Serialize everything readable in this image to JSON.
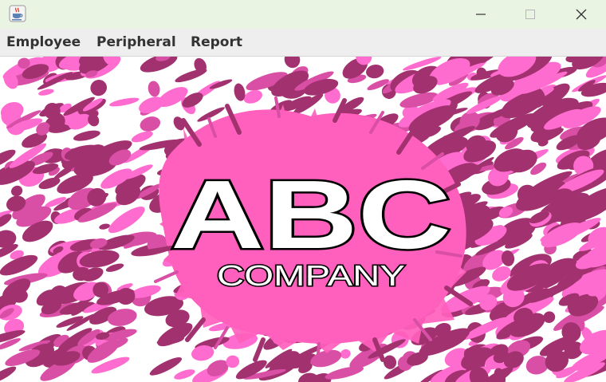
{
  "window": {
    "app_icon": "java-coffee-cup-icon",
    "controls": {
      "minimize": "minimize-icon",
      "maximize": "maximize-icon",
      "close": "close-icon"
    }
  },
  "menu": {
    "items": [
      {
        "label": "Employee"
      },
      {
        "label": "Peripheral"
      },
      {
        "label": "Report"
      }
    ]
  },
  "banner": {
    "logo_main": "ABC",
    "logo_sub": "COMPANY"
  },
  "colors": {
    "titlebar_bg": "#e9f5e2",
    "menubar_bg": "#eeeeee",
    "camo_light_pink": "#ff6ccf",
    "camo_mid_pink": "#d94fa6",
    "camo_dark_magenta": "#a2326f",
    "splash_pink": "#ff5fbd"
  }
}
